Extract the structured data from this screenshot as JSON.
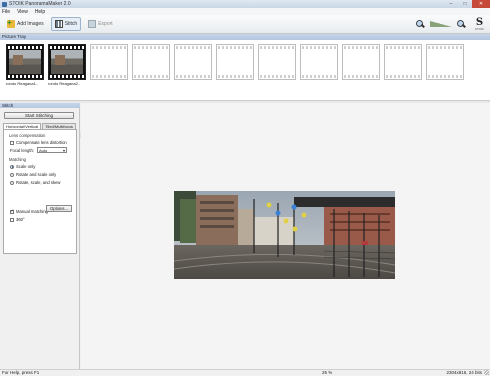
{
  "window": {
    "title": "STOIK PanoramaMaker 2.0",
    "buttons": [
      "–",
      "□",
      "✕"
    ]
  },
  "menu": [
    "File",
    "View",
    "Help"
  ],
  "toolbar": {
    "add_images": "Add Images",
    "stitch": "Stitch",
    "export": "Export",
    "logo_text": "S",
    "logo_sub": "STOIK"
  },
  "tray": {
    "label": "Picture Tray",
    "items": [
      {
        "caption": "rondo Reagana1..",
        "filled": true
      },
      {
        "caption": "rondo Reagana2..",
        "filled": true
      },
      {
        "caption": "",
        "filled": false
      },
      {
        "caption": "",
        "filled": false
      },
      {
        "caption": "",
        "filled": false
      },
      {
        "caption": "",
        "filled": false
      },
      {
        "caption": "",
        "filled": false
      },
      {
        "caption": "",
        "filled": false
      },
      {
        "caption": "",
        "filled": false
      },
      {
        "caption": "",
        "filled": false
      },
      {
        "caption": "",
        "filled": false
      }
    ]
  },
  "stitch_panel": {
    "label": "Stitch",
    "start_button": "Start Stitching",
    "tabs": [
      "Horizontal/Vertical",
      "Tiled/Multifocus"
    ],
    "lens_group": "Lens compensation",
    "compensate_label": "Compensate lens distortion",
    "focal_label": "Focal length:",
    "focal_value": "Auto",
    "matching_group": "Matching",
    "options": [
      "Scale only",
      "Rotate and scale only",
      "Rotate, scale, and skew"
    ],
    "manual_matching": "Manual matching",
    "options_button": "Options...",
    "deg360": "360°"
  },
  "status": {
    "help": "For Help, press F1",
    "zoom": "25 %",
    "info": "2304x815, 24 bits"
  }
}
